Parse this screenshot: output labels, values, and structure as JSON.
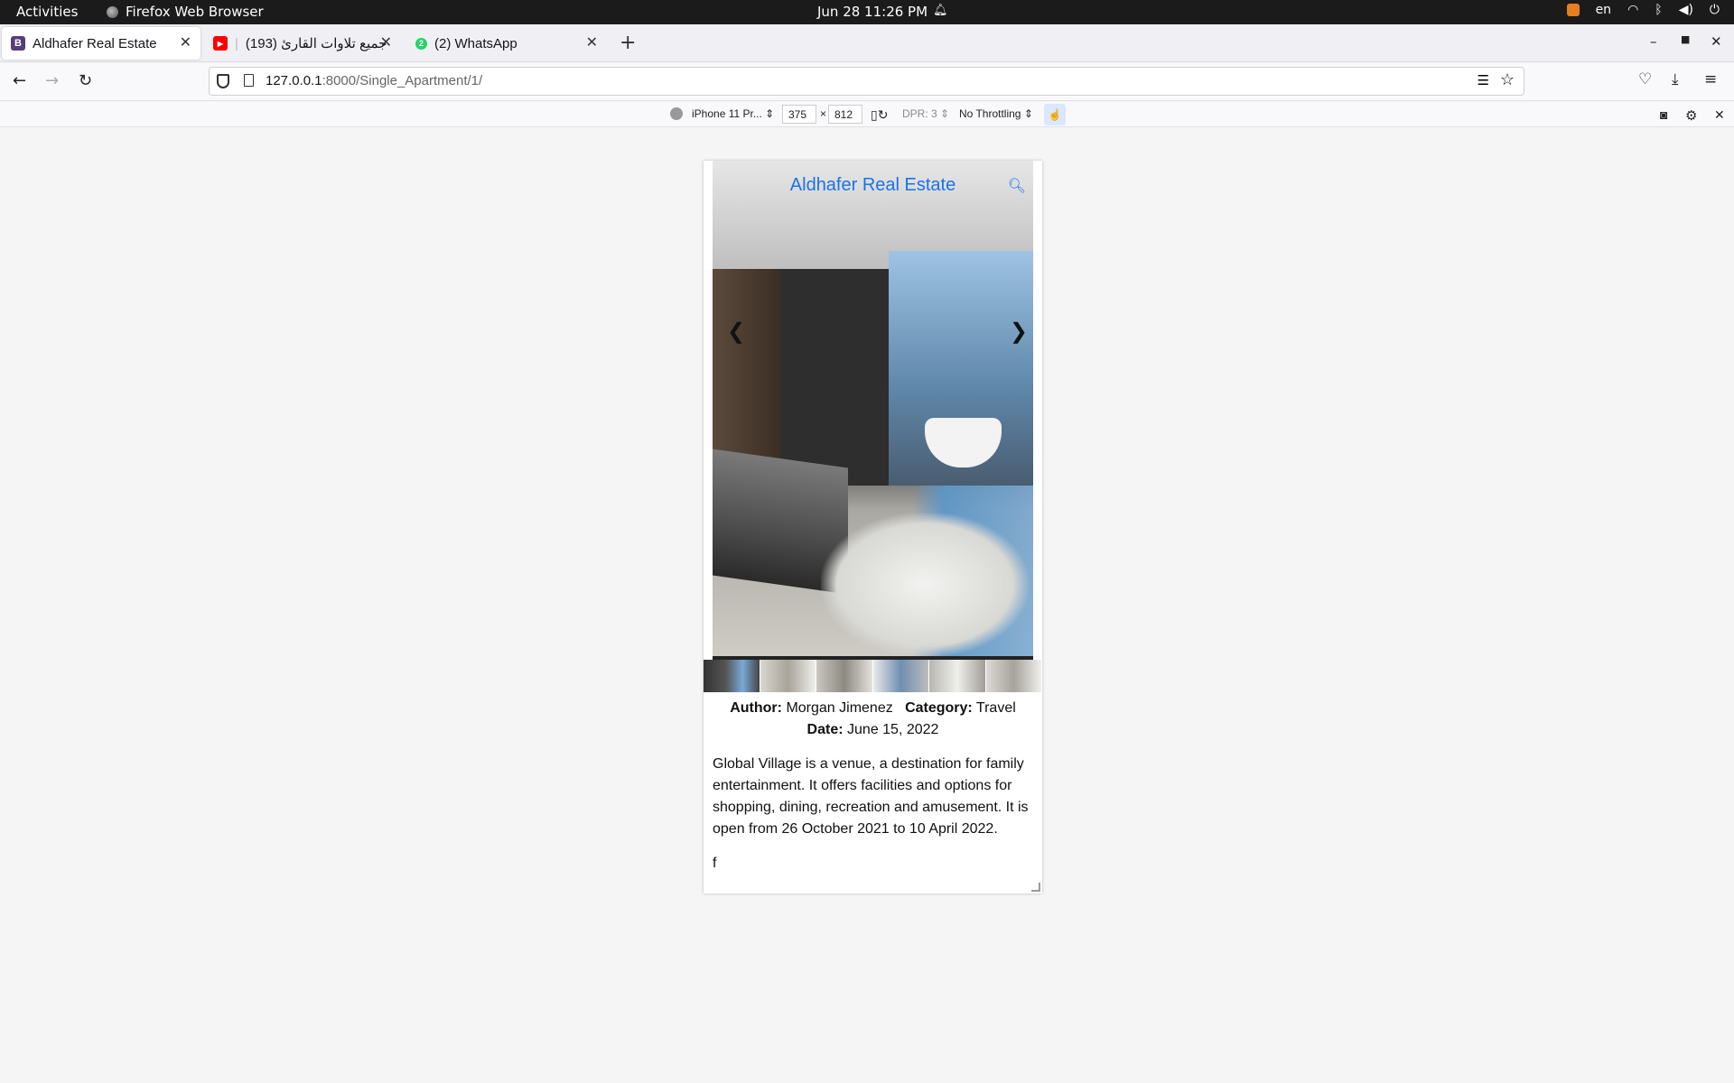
{
  "system_bar": {
    "activities": "Activities",
    "app_name": "Firefox Web Browser",
    "clock": "Jun 28  11:26 PM",
    "language": "en"
  },
  "tabs": [
    {
      "title": "Aldhafer Real Estate",
      "favicon": "B",
      "favicon_color": "#563d7c"
    },
    {
      "title": "(193) جميع تلاوات القارئ",
      "favicon": "▶",
      "favicon_color": "#ff0000"
    },
    {
      "title": "(2) WhatsApp",
      "favicon": "2",
      "favicon_color": "#25d366"
    }
  ],
  "url": {
    "host": "127.0.0.1",
    "path": ":8000/Single_Apartment/1/"
  },
  "rdm": {
    "device": "iPhone 11 Pr...",
    "width": "375",
    "times": "×",
    "height": "812",
    "dpr": "DPR: 3",
    "throttling": "No Throttling"
  },
  "site": {
    "title": "Aldhafer Real Estate",
    "prev": "❮",
    "next": "❯",
    "author_label": "Author:",
    "author": "Morgan Jimenez",
    "category_label": "Category:",
    "category": "Travel",
    "date_label": "Date:",
    "date": "June 15, 2022",
    "description": "Global Village is a venue, a destination for family entertainment. It offers facilities and options for shopping, dining, recreation and amusement. It is open from 26 October 2021 to 10 April 2022.",
    "extra": "f"
  },
  "colors": {
    "accent": "#1a73e8"
  }
}
